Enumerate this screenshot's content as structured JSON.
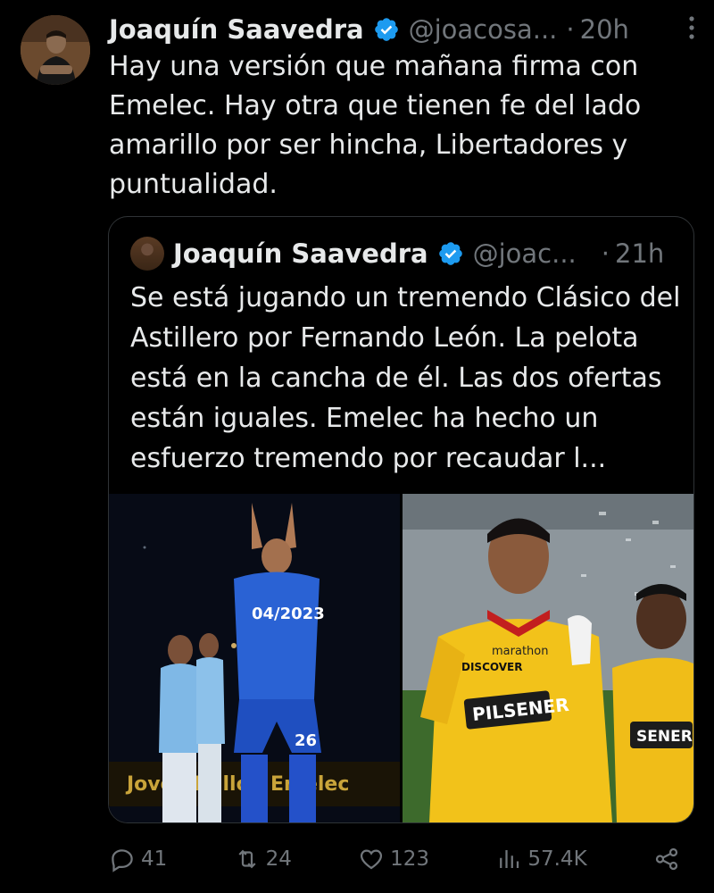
{
  "tweet": {
    "author_name": "Joaquín Saavedra",
    "handle": "@joacosa...",
    "separator": "·",
    "time": "20h",
    "more_icon": "ellipsis-vertical-icon",
    "text": "Hay una versión que mañana firma con Emelec. Hay otra que tienen fe del lado amarillo por ser hincha, Libertadores y puntualidad.",
    "accent_color": "#1d9bf0"
  },
  "quoted_tweet": {
    "author_name": "Joaquín Saavedra",
    "handle": "@joac...",
    "separator": "·",
    "time": "21h",
    "text": "Se está jugando un tremendo Clásico del Astillero por Fernando León. La pelota está en la cancha de él. Las dos ofertas están iguales. Emelec ha hecho un esfuerzo tremendo por recaudar l...",
    "images": [
      {
        "jersey_text": "04/2023",
        "number": "26",
        "sponsor_strip": "Joven  Ballon  Emelec"
      },
      {
        "sponsor_top": "marathon",
        "sponsor_mid": "DISCOVER",
        "sponsor_main": "PILSENER",
        "sponsor_side": "SENER"
      }
    ]
  },
  "actions": {
    "replies": "41",
    "reposts": "24",
    "likes": "123",
    "views": "57.4K"
  }
}
